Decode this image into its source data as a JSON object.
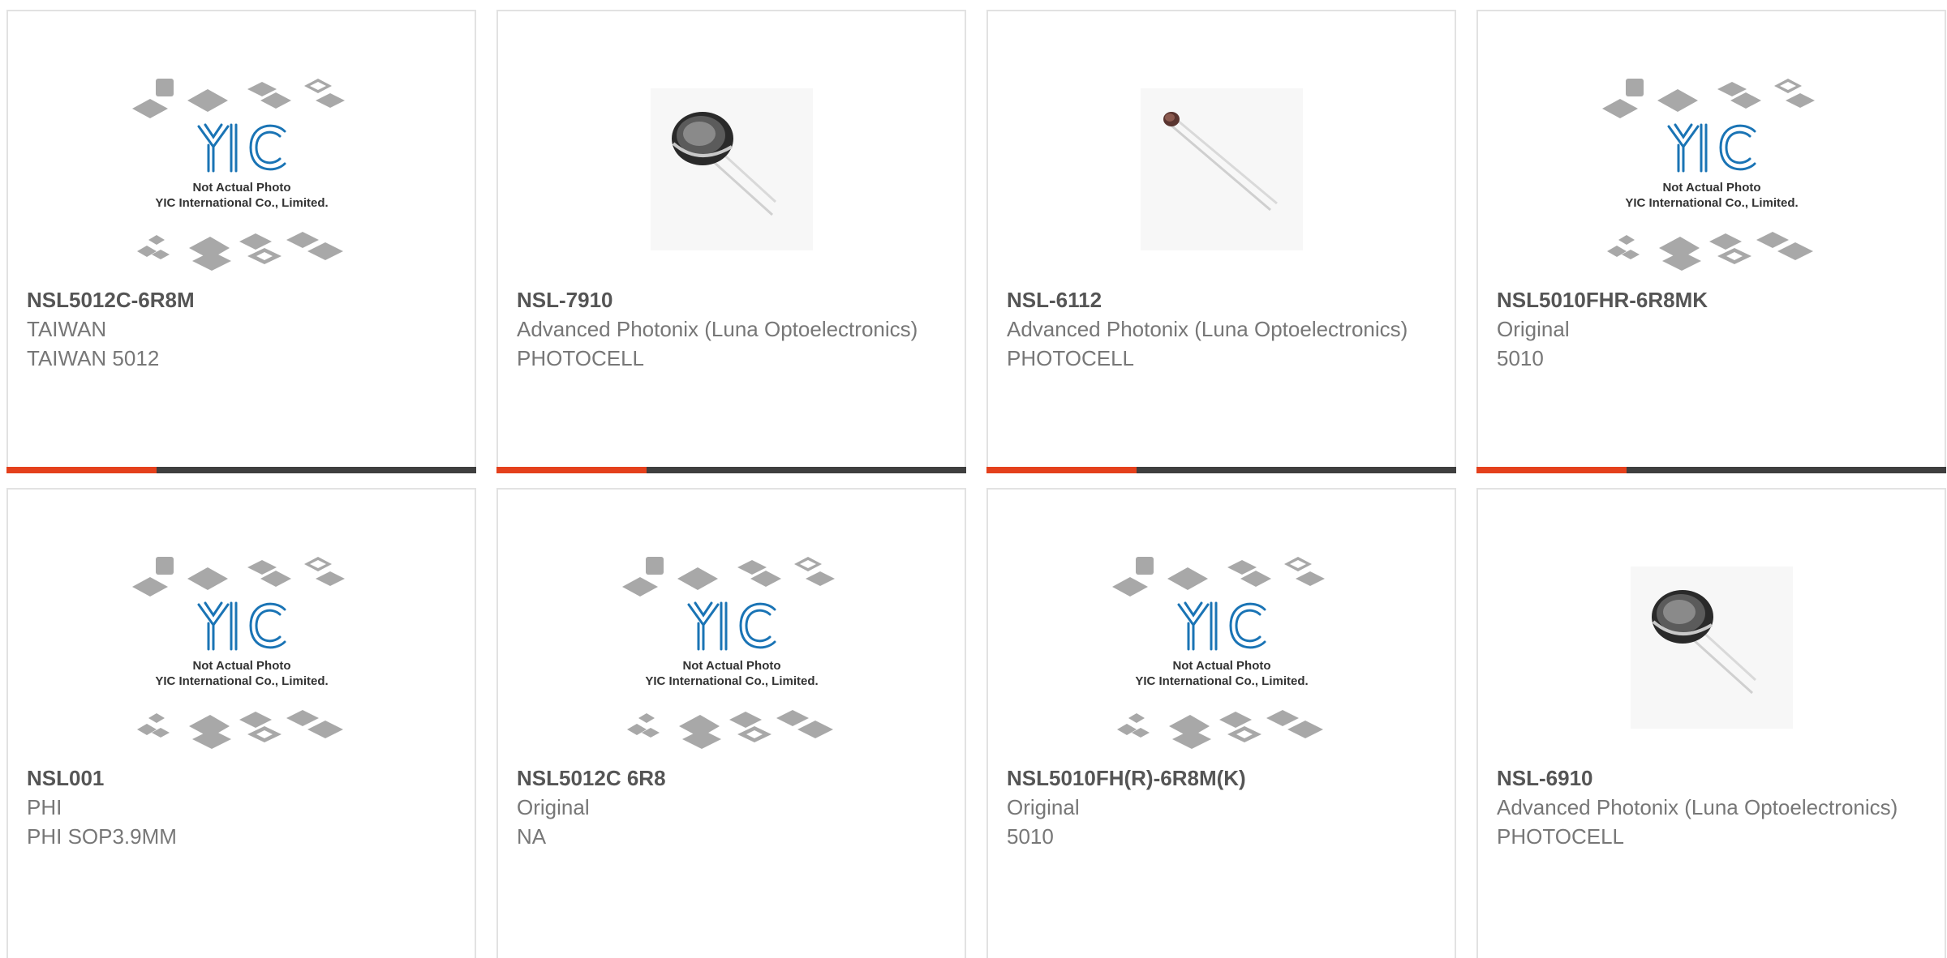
{
  "theme": {
    "accent": "#e4401c",
    "bar": "#3f3f3f",
    "border": "#e2e2e2",
    "pn_color": "#555555",
    "text_color": "#777777",
    "logo_blue": "#1a74b5"
  },
  "placeholder": {
    "line1": "Not Actual Photo",
    "line2": "YIC International Co., Limited.",
    "logo_text": "YIC"
  },
  "products": [
    {
      "pn": "NSL5012C-6R8M",
      "mfr": "TAIWAN",
      "desc": "TAIWAN 5012",
      "image": "placeholder-image"
    },
    {
      "pn": "NSL-7910",
      "mfr": "Advanced Photonix (Luna Optoelectronics)",
      "desc": "PHOTOCELL",
      "image": "photocell-large"
    },
    {
      "pn": "NSL-6112",
      "mfr": "Advanced Photonix (Luna Optoelectronics)",
      "desc": "PHOTOCELL",
      "image": "photocell-small"
    },
    {
      "pn": "NSL5010FHR-6R8MK",
      "mfr": "Original",
      "desc": "5010",
      "image": "placeholder-image"
    },
    {
      "pn": "NSL001",
      "mfr": "PHI",
      "desc": "PHI SOP3.9MM",
      "image": "placeholder-image"
    },
    {
      "pn": "NSL5012C 6R8",
      "mfr": "Original",
      "desc": "NA",
      "image": "placeholder-image"
    },
    {
      "pn": "NSL5010FH(R)-6R8M(K)",
      "mfr": "Original",
      "desc": "5010",
      "image": "placeholder-image"
    },
    {
      "pn": "NSL-6910",
      "mfr": "Advanced Photonix (Luna Optoelectronics)",
      "desc": "PHOTOCELL",
      "image": "photocell-large"
    }
  ]
}
